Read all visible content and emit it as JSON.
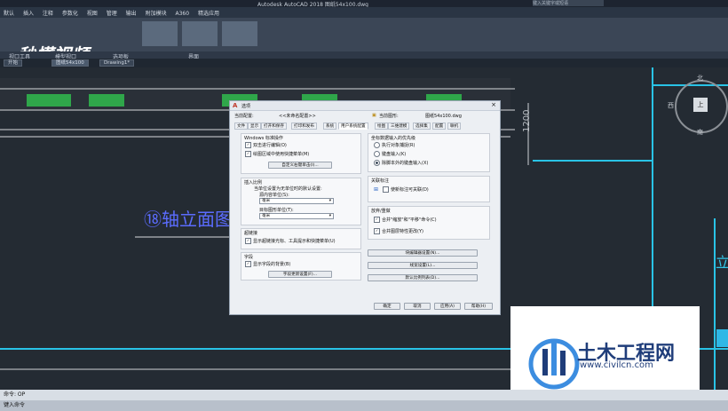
{
  "app": {
    "title": "Autodesk AutoCAD 2018  图纸54x100.dwg",
    "search_placeholder": "键入关键字或短语",
    "menu": [
      "默认",
      "插入",
      "注释",
      "参数化",
      "视图",
      "管理",
      "输出",
      "附加模块",
      "A360",
      "精选应用"
    ],
    "ribbon_groups": [
      "视口工具",
      "模型视口",
      "选项板",
      "界面"
    ],
    "file_tabs": [
      "开始",
      "图纸54x100",
      "Drawing1*"
    ],
    "command": {
      "history": "命令: OP",
      "prompt": "键入命令"
    },
    "watermark": "秒懂视频"
  },
  "dialog": {
    "title": "选项",
    "current_profile_label": "当前配置:",
    "current_profile_value": "<<未命名配置>>",
    "current_drawing_label": "当前图形:",
    "current_drawing_value": "图纸54x100.dwg",
    "tabs": [
      "文件",
      "显示",
      "打开和保存",
      "打印和发布",
      "系统",
      "用户系统配置",
      "绘图",
      "三维建模",
      "选择集",
      "配置",
      "联机"
    ],
    "active_tab": "用户系统配置",
    "windows_group": {
      "title": "Windows 标准操作",
      "dblclick_edit": "双击进行编辑(O)",
      "shortcut_menu": "绘图区域中使用快捷菜单(M)",
      "custom_right_click": "自定义右键单击(I)..."
    },
    "insert_scale_group": {
      "title": "插入比例",
      "desc": "当单位设置为无单位时的默认设置:",
      "source_label": "源内容单位(S):",
      "source_value": "毫米",
      "target_label": "目标图形单位(T):",
      "target_value": "毫米"
    },
    "hyperlink_group": {
      "title": "超链接",
      "show_cursor": "显示超链接光标、工具提示和快捷菜单(U)"
    },
    "field_group": {
      "title": "字段",
      "show_bg": "显示字段的背景(B)",
      "update_settings": "字段更新设置(F)..."
    },
    "priority_group": {
      "title": "坐标数据输入的优先级",
      "options": [
        "执行对象捕捉(R)",
        "键盘输入(K)",
        "除脚本外的键盘输入(X)"
      ],
      "selected_index": 2
    },
    "assoc_dim_group": {
      "title": "关联标注",
      "make_assoc": "使新标注可关联(D)"
    },
    "undo_group": {
      "title": "放弃/重做",
      "zoom_pan": "合并\"缩放\"和\"平移\"命令(C)",
      "layer_prop": "合并图层特性更改(Y)"
    },
    "right_buttons": [
      "块编辑器设置(N)...",
      "线宽设置(L)...",
      "默认比例列表(D)..."
    ],
    "footer_buttons": [
      "确定",
      "取消",
      "应用(A)",
      "帮助(H)"
    ]
  },
  "drawing": {
    "axis_title": "⑱轴立面图",
    "dimension": "1200",
    "compass": {
      "north": "北",
      "south": "南",
      "west": "西",
      "top": "上"
    },
    "side_text": "立"
  },
  "watermark_site": {
    "name": "土木工程网",
    "url": "www.civilcn.com"
  }
}
